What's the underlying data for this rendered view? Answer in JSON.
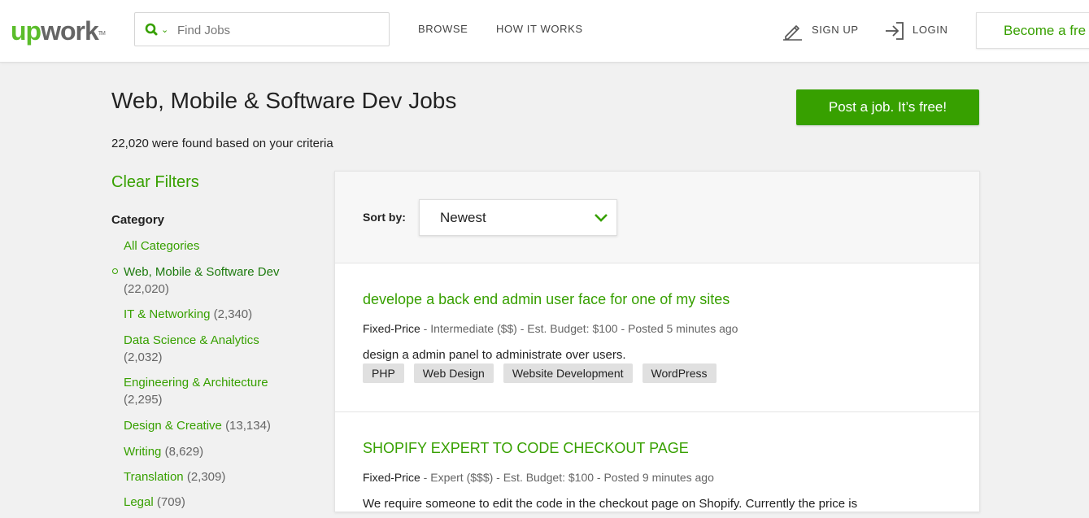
{
  "header": {
    "logo_up": "up",
    "logo_work": "work",
    "logo_tm": "TM",
    "search": {
      "placeholder": "Find Jobs",
      "icon": "search-icon"
    },
    "nav": {
      "browse": "BROWSE",
      "how_it_works": "HOW IT WORKS"
    },
    "sign_up": "SIGN UP",
    "login": "LOGIN",
    "become": "Become a fre"
  },
  "page": {
    "title": "Web, Mobile & Software Dev Jobs",
    "found_text": "22,020 were found based on your criteria",
    "post_job_label": "Post a job. It’s free!"
  },
  "sidebar": {
    "clear_filters": "Clear Filters",
    "category_heading": "Category",
    "categories": [
      {
        "name": "All Categories",
        "count": ""
      },
      {
        "name": "Web, Mobile & Software Dev",
        "count": "(22,020)"
      },
      {
        "name": "IT & Networking",
        "count": "(2,340)"
      },
      {
        "name": "Data Science & Analytics",
        "count": "(2,032)"
      },
      {
        "name": "Engineering & Architecture",
        "count": "(2,295)"
      },
      {
        "name": "Design & Creative",
        "count": "(13,134)"
      },
      {
        "name": "Writing",
        "count": "(8,629)"
      },
      {
        "name": "Translation",
        "count": "(2,309)"
      },
      {
        "name": "Legal",
        "count": "(709)"
      }
    ]
  },
  "sort": {
    "label": "Sort by:",
    "value": "Newest"
  },
  "jobs": [
    {
      "title": "develope a back end admin user face for one of my sites",
      "type": "Fixed-Price",
      "meta_rest": " - Intermediate ($$) - Est. Budget: $100 - Posted 5 minutes ago",
      "description": "design a admin panel to administrate over users.",
      "tags": [
        "PHP",
        "Web Design",
        "Website Development",
        "WordPress"
      ]
    },
    {
      "title": "SHOPIFY EXPERT TO CODE CHECKOUT PAGE",
      "type": "Fixed-Price",
      "meta_rest": " - Expert ($$$) - Est. Budget: $100 - Posted 9 minutes ago",
      "description": "We require someone to edit the code in the checkout page on Shopify. Currently the price is"
    }
  ],
  "colors": {
    "brand_green": "#37a000",
    "background": "#f1f1f1"
  }
}
